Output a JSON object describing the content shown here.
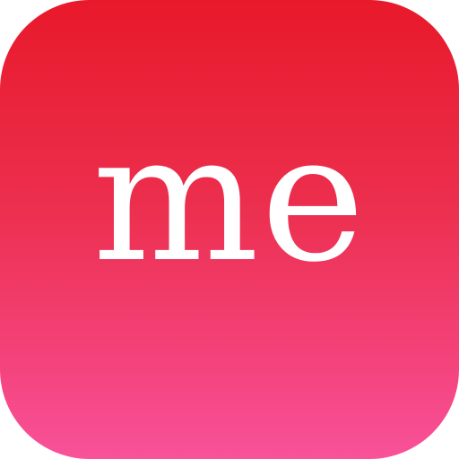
{
  "app_icon": {
    "logo_text": "me",
    "colors": {
      "gradient_top": "#e8192a",
      "gradient_bottom": "#f8529a",
      "text": "#ffffff"
    }
  }
}
